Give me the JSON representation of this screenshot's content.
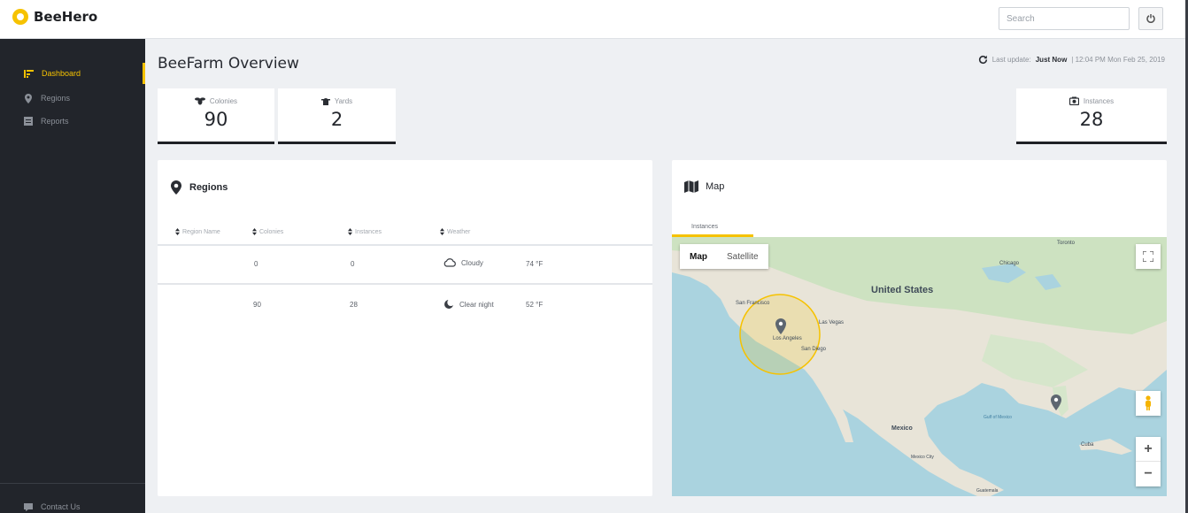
{
  "app": {
    "name": "BeeHero"
  },
  "header": {
    "search_placeholder": "Search"
  },
  "sidebar": {
    "items": [
      {
        "label": "Dashboard",
        "icon": "dashboard-icon"
      },
      {
        "label": "Regions",
        "icon": "location-icon"
      },
      {
        "label": "Reports",
        "icon": "report-icon"
      }
    ],
    "footer": {
      "label": "Contact Us",
      "icon": "chat-icon"
    }
  },
  "page": {
    "title": "BeeFarm Overview",
    "last_update_label": "Last update:",
    "last_update_value": "Just Now",
    "last_update_time": "| 12:04 PM Mon Feb 25, 2019"
  },
  "stats": [
    {
      "label": "Colonies",
      "value": "90",
      "icon": "bee-icon"
    },
    {
      "label": "Yards",
      "value": "2",
      "icon": "hive-icon"
    },
    {
      "label": "Instances",
      "value": "28",
      "icon": "camera-icon"
    }
  ],
  "regions": {
    "title": "Regions",
    "columns": [
      "Region Name",
      "Colonies",
      "Instances",
      "Weather"
    ],
    "rows": [
      {
        "name": "",
        "colonies": "0",
        "instances": "0",
        "weather": "Cloudy",
        "weather_icon": "cloud-icon",
        "temp": "74 °F"
      },
      {
        "name": "",
        "colonies": "90",
        "instances": "28",
        "weather": "Clear night",
        "weather_icon": "clear-night-icon",
        "temp": "52 °F"
      }
    ]
  },
  "map": {
    "title": "Map",
    "tab": "Instances",
    "type_options": [
      "Map",
      "Satellite"
    ],
    "selected_type": "Map",
    "labels": {
      "country": "United States",
      "san_francisco": "San Francisco",
      "las_vegas": "Las Vegas",
      "los_angeles": "Los Angeles",
      "san_diego": "San Diego",
      "chicago": "Chicago",
      "toronto": "Toronto",
      "mexico": "Mexico",
      "cuba": "Cuba",
      "gulf": "Gulf of Mexico",
      "mexico_city": "Mexico City",
      "guatemala": "Guatemala"
    },
    "controls": {
      "zoom_in": "+",
      "zoom_out": "−"
    }
  },
  "colors": {
    "accent": "#f6c200",
    "sidebar": "#22252b",
    "background": "#eef0f3"
  }
}
